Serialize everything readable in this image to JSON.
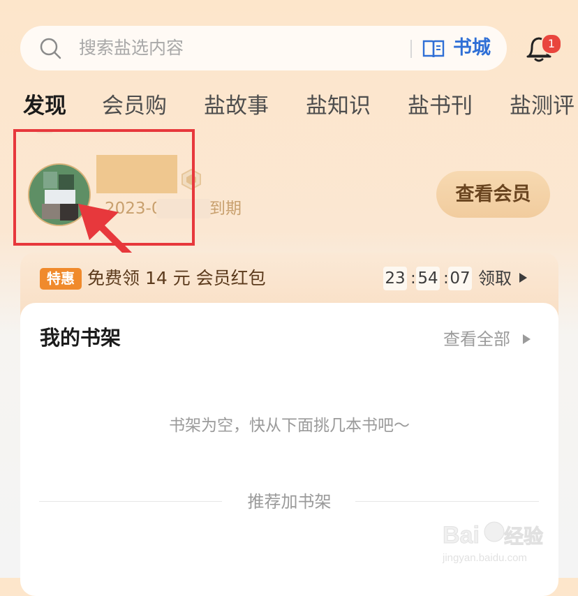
{
  "search": {
    "placeholder": "搜索盐选内容",
    "store_label": "书城"
  },
  "notifications": {
    "badge_count": "1"
  },
  "tabs": [
    {
      "label": "发现",
      "active": true
    },
    {
      "label": "会员购",
      "active": false
    },
    {
      "label": "盐故事",
      "active": false
    },
    {
      "label": "盐知识",
      "active": false
    },
    {
      "label": "盐书刊",
      "active": false
    },
    {
      "label": "盐测评",
      "active": false
    }
  ],
  "profile": {
    "expiry_prefix": "2023-0",
    "expiry_suffix": "到期",
    "view_membership_label": "查看会员"
  },
  "promo": {
    "tag": "特惠",
    "text": "免费领 14 元 会员红包",
    "countdown": {
      "hours": "23",
      "minutes": "54",
      "seconds": "07",
      "separator": ":"
    },
    "claim_label": "领取"
  },
  "bookshelf": {
    "title": "我的书架",
    "view_all_label": "查看全部",
    "empty_message": "书架为空，快从下面挑几本书吧～",
    "recommend_label": "推荐加书架"
  },
  "watermark": {
    "brand": "Baidu",
    "product": "经验",
    "url": "jingyan.baidu.com"
  },
  "colors": {
    "accent_blue": "#2f6fd6",
    "annotation_red": "#e7383c",
    "badge_red": "#e9453d",
    "tag_orange": "#f08a2c"
  }
}
